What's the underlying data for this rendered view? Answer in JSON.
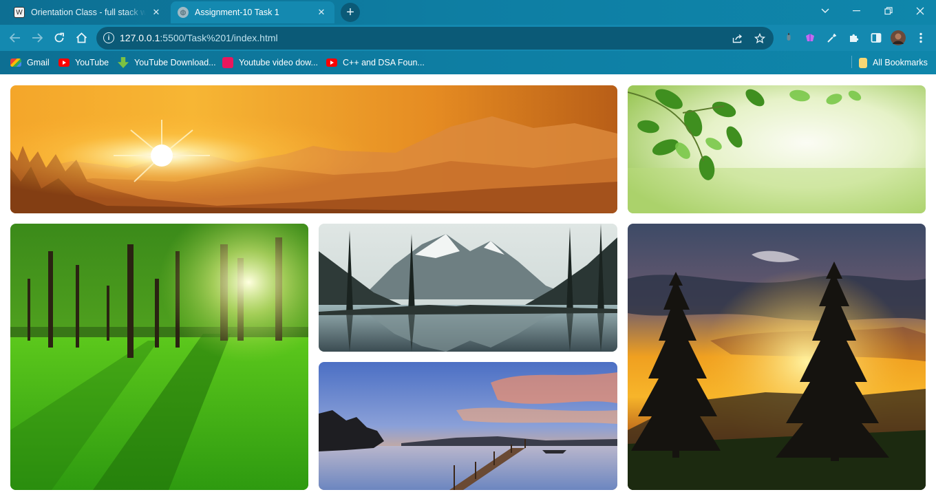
{
  "browser": {
    "tabs": [
      {
        "title": "Orientation Class - full stack web",
        "favicon": "wordpress-icon",
        "active": false
      },
      {
        "title": "Assignment-10 Task 1",
        "favicon": "globe-icon",
        "active": true
      }
    ],
    "address": {
      "host": "127.0.0.1",
      "rest": ":5500/Task%201/index.html"
    },
    "bookmarks": [
      {
        "label": "Gmail",
        "icon": "gmail-icon"
      },
      {
        "label": "YouTube",
        "icon": "youtube-icon"
      },
      {
        "label": "YouTube Download...",
        "icon": "download-icon"
      },
      {
        "label": "Youtube video dow...",
        "icon": "u-icon"
      },
      {
        "label": "C++ and DSA Foun...",
        "icon": "youtube-icon"
      }
    ],
    "all_bookmarks_label": "All Bookmarks",
    "theme_color": "#0f7fa4"
  },
  "gallery": {
    "images": [
      {
        "subject": "sunset-mountains"
      },
      {
        "subject": "green-leaves"
      },
      {
        "subject": "sunlit-forest"
      },
      {
        "subject": "mountain-lake-reflection"
      },
      {
        "subject": "lake-pier-sunset"
      },
      {
        "subject": "pine-trees-sunset"
      }
    ]
  }
}
